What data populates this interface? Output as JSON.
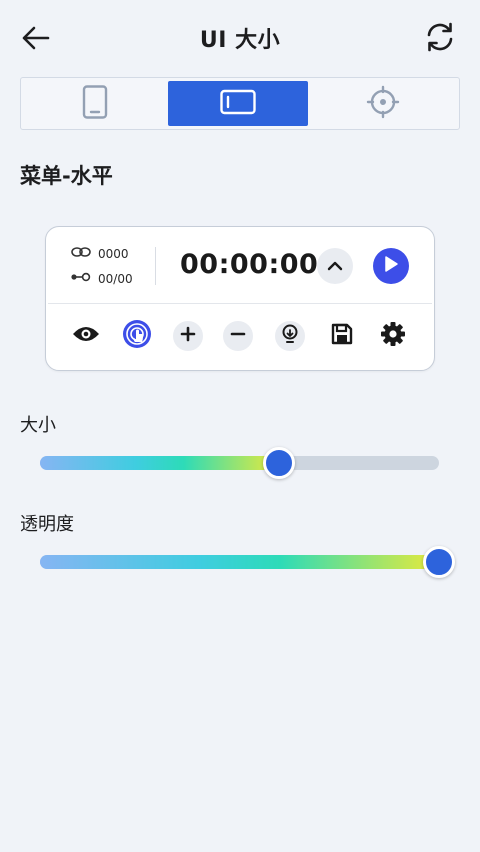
{
  "header": {
    "title": "UI 大小",
    "back_icon": "arrow-left-icon",
    "refresh_icon": "refresh-icon"
  },
  "tabs": [
    {
      "icon": "phone-portrait-icon",
      "selected": false
    },
    {
      "icon": "tablet-landscape-icon",
      "selected": true
    },
    {
      "icon": "crosshair-icon",
      "selected": false
    }
  ],
  "section_title": "菜单-水平",
  "menu_preview": {
    "loop_count": "0000",
    "step_count": "00/00",
    "timer": "00:00:00",
    "tools": [
      "eye-icon",
      "touch-icon",
      "plus-icon",
      "minus-icon",
      "bulb-icon",
      "save-icon",
      "gear-icon"
    ]
  },
  "sliders": {
    "size": {
      "label": "大小",
      "value_percent": 60
    },
    "opacity": {
      "label": "透明度",
      "value_percent": 100
    }
  },
  "colors": {
    "accent": "#2d63dc",
    "play": "#3d4ee8",
    "background": "#f0f3f8"
  }
}
